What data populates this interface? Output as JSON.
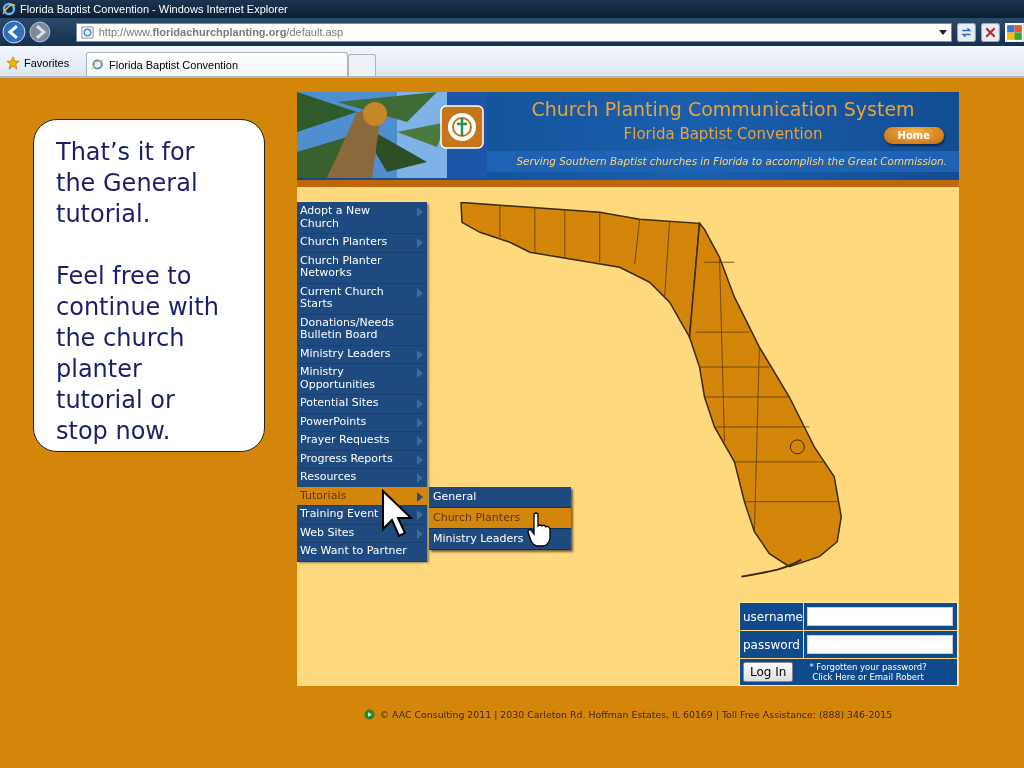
{
  "browser": {
    "title": "Florida Baptist Convention - Windows Internet Explorer",
    "address": "http://www.**floridachurchplanting.org**/default.asp",
    "favorites": "Favorites",
    "tabs": [
      {
        "label": "Florida Baptist Convention",
        "selected": true
      }
    ]
  },
  "callout": {
    "paragraphs": [
      "That’s it for the General tutorial.",
      "Feel free to continue with the church planter tutorial or stop now."
    ]
  },
  "header": {
    "title": "Church Planting Communication System",
    "subtitle": "Florida Baptist Convention",
    "home_button": "Home",
    "tagline": "Serving Southern Baptist churches in Florida to accomplish the Great Commission."
  },
  "menu": {
    "items": [
      {
        "label": "Adopt a New Church",
        "has_submenu": true,
        "selected": false
      },
      {
        "label": "Church Planters",
        "has_submenu": true,
        "selected": false
      },
      {
        "label": "Church Planter Networks",
        "has_submenu": false,
        "selected": false
      },
      {
        "label": "Current Church Starts",
        "has_submenu": true,
        "selected": false
      },
      {
        "label": "Donations/Needs Bulletin Board",
        "has_submenu": false,
        "selected": false
      },
      {
        "label": "Ministry Leaders",
        "has_submenu": true,
        "selected": false
      },
      {
        "label": "Ministry Opportunities",
        "has_submenu": true,
        "selected": false
      },
      {
        "label": "Potential Sites",
        "has_submenu": true,
        "selected": false
      },
      {
        "label": "PowerPoints",
        "has_submenu": true,
        "selected": false
      },
      {
        "label": "Prayer Requests",
        "has_submenu": true,
        "selected": false
      },
      {
        "label": "Progress Reports",
        "has_submenu": true,
        "selected": false
      },
      {
        "label": "Resources",
        "has_submenu": true,
        "selected": false
      },
      {
        "label": "Tutorials",
        "has_submenu": true,
        "selected": true
      },
      {
        "label": "Training Event",
        "has_submenu": true,
        "selected": false
      },
      {
        "label": "Web Sites",
        "has_submenu": true,
        "selected": false
      },
      {
        "label": "We Want to Partner",
        "has_submenu": false,
        "selected": false
      }
    ],
    "submenu": [
      {
        "label": "General",
        "selected": false
      },
      {
        "label": "Church Planters",
        "selected": true
      },
      {
        "label": "Ministry Leaders",
        "selected": false
      }
    ]
  },
  "login": {
    "username_label": "username",
    "password_label": "password",
    "button": "Log In",
    "forgot_lines": [
      "* Forgotten your password?",
      "Click Here or Email Robert"
    ]
  },
  "footer": "© AAC Consulting 2011 | 2030 Carleton Rd. Hoffman Estates, IL 60169 | Toll Free Assistance: (888) 346-2015"
}
